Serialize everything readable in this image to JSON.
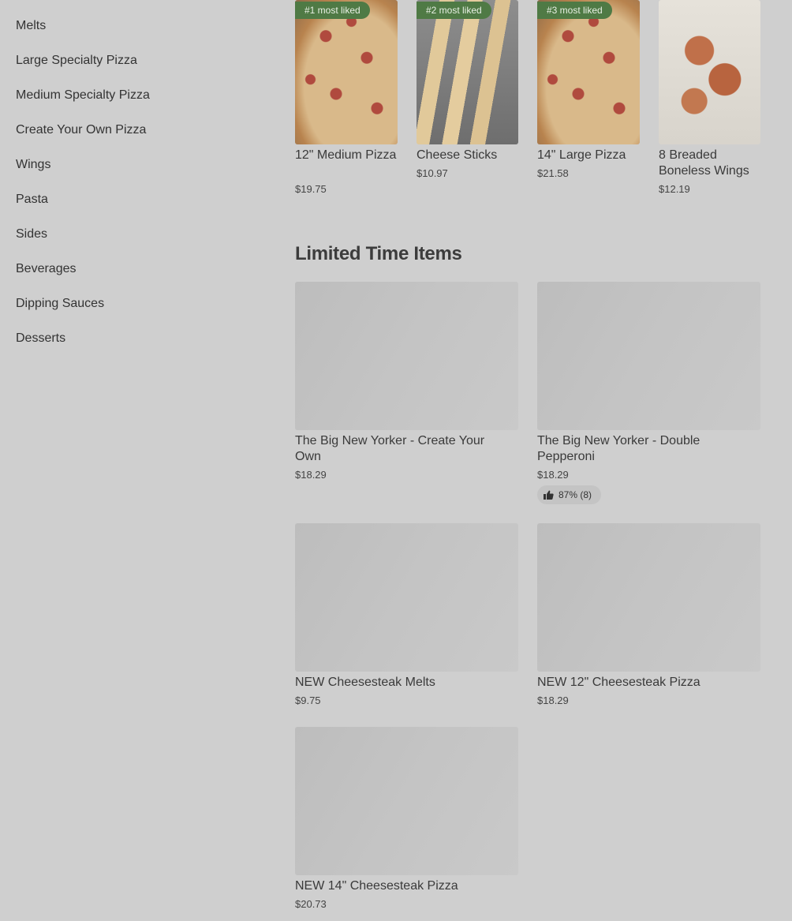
{
  "sidebar": {
    "items": [
      {
        "label": "Melts"
      },
      {
        "label": "Large Specialty Pizza"
      },
      {
        "label": "Medium Specialty Pizza"
      },
      {
        "label": "Create Your Own Pizza"
      },
      {
        "label": "Wings"
      },
      {
        "label": "Pasta"
      },
      {
        "label": "Sides"
      },
      {
        "label": "Beverages"
      },
      {
        "label": "Dipping Sauces"
      },
      {
        "label": "Desserts"
      }
    ]
  },
  "most_liked": [
    {
      "badge": "#1 most liked",
      "title": "12\" Medium Pizza",
      "price": "$19.75",
      "image": "pizza"
    },
    {
      "badge": "#2 most liked",
      "title": "Cheese Sticks",
      "price": "$10.97",
      "image": "cheese-sticks"
    },
    {
      "badge": "#3 most liked",
      "title": "14\" Large Pizza",
      "price": "$21.58",
      "image": "pizza"
    },
    {
      "badge": "",
      "title": "8 Breaded Boneless Wings",
      "price": "$12.19",
      "image": "wings"
    }
  ],
  "limited_time": {
    "title": "Limited Time Items",
    "items": [
      {
        "title": "The Big New Yorker - Create Your Own",
        "price": "$18.29"
      },
      {
        "title": "The Big New Yorker - Double Pepperoni",
        "price": "$18.29",
        "rating": "87% (8)",
        "rating_icon": "thumbs-up-icon"
      },
      {
        "title": "NEW Cheesesteak Melts",
        "price": "$9.75"
      },
      {
        "title": "NEW 12\" Cheesesteak Pizza",
        "price": "$18.29"
      },
      {
        "title": "NEW 14\" Cheesesteak Pizza",
        "price": "$20.73"
      }
    ]
  },
  "colors": {
    "background": "#cfcfcf",
    "badge": "#4f7a45",
    "placeholder": "#c2c2c2"
  }
}
